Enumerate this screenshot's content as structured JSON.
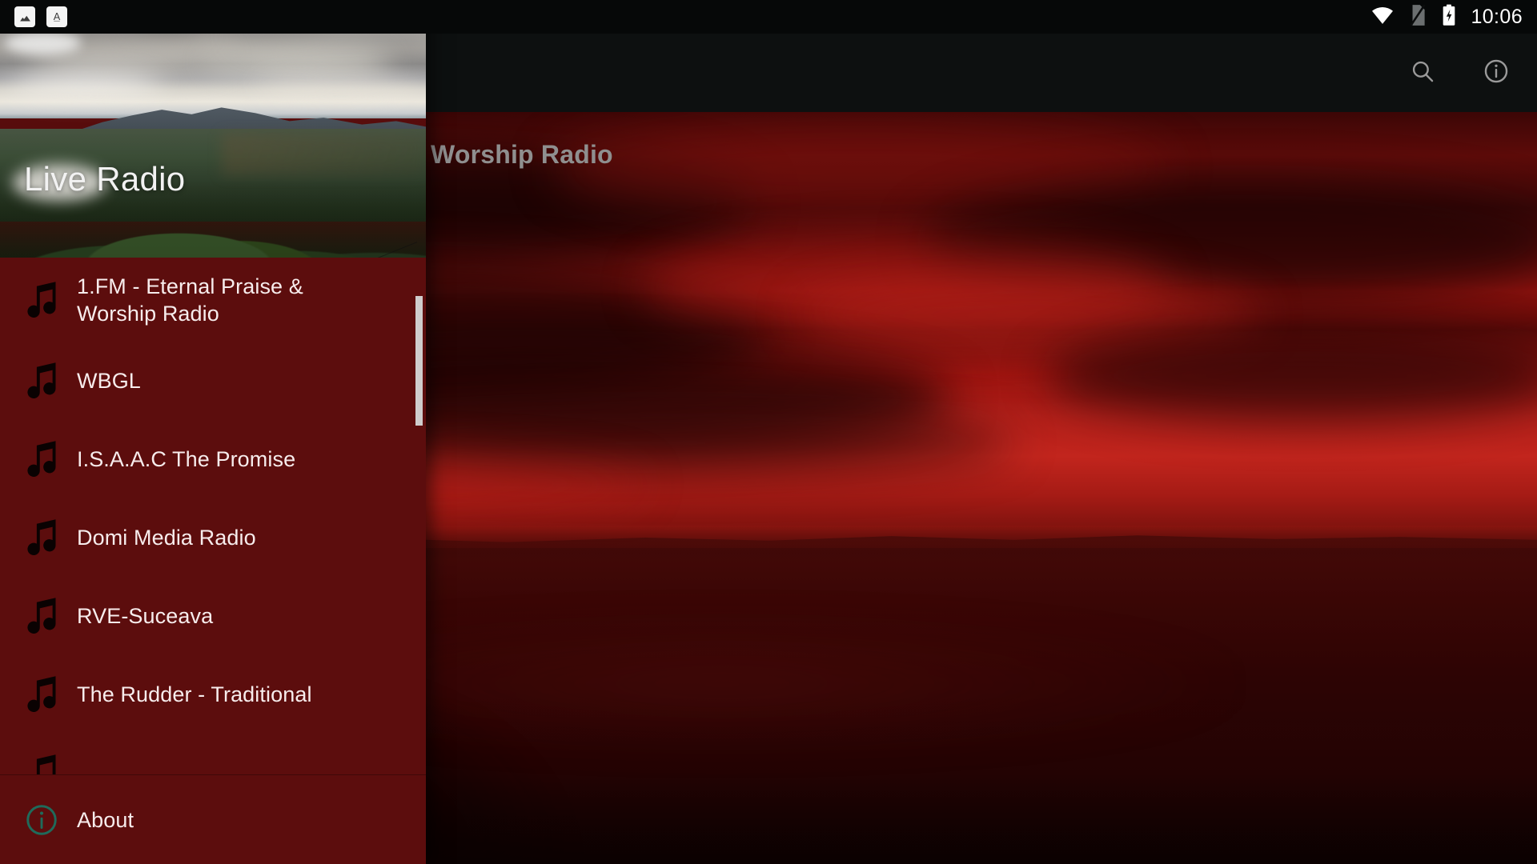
{
  "status_bar": {
    "notifications": [
      {
        "icon": "image-icon",
        "name": "image-notification"
      },
      {
        "icon": "text-font-icon",
        "name": "font-notification"
      }
    ],
    "system_icons": [
      {
        "icon": "wifi-icon"
      },
      {
        "icon": "sim-card-off-icon"
      },
      {
        "icon": "battery-charging-icon"
      }
    ],
    "time": "10:06",
    "background_color": "#060808"
  },
  "toolbar": {
    "title": "Worship Radio",
    "title_color": "#8f8f8f",
    "background_color": "#0d1010",
    "actions": [
      {
        "name": "search-button",
        "icon": "search-icon",
        "label": "Search"
      },
      {
        "name": "info-button",
        "icon": "info-icon",
        "label": "Info"
      }
    ]
  },
  "drawer": {
    "header_title": "Live Radio",
    "background_color": "#5c0d0d",
    "accent_color": "#cfcccc",
    "items": [
      {
        "label": "1.FM - Eternal Praise & Worship Radio",
        "icon": "music-note-icon"
      },
      {
        "label": "WBGL",
        "icon": "music-note-icon"
      },
      {
        "label": "I.S.A.A.C The Promise",
        "icon": "music-note-icon"
      },
      {
        "label": "Domi Media Radio",
        "icon": "music-note-icon"
      },
      {
        "label": "RVE-Suceava",
        "icon": "music-note-icon"
      },
      {
        "label": "The Rudder - Traditional",
        "icon": "music-note-icon"
      }
    ],
    "footer": {
      "label": "About",
      "icon": "info-circle-icon",
      "icon_color": "#1f6b5b"
    },
    "scrollbar": {
      "name": "drawer-scrollbar",
      "thumb_color": "#cfcccc"
    }
  }
}
